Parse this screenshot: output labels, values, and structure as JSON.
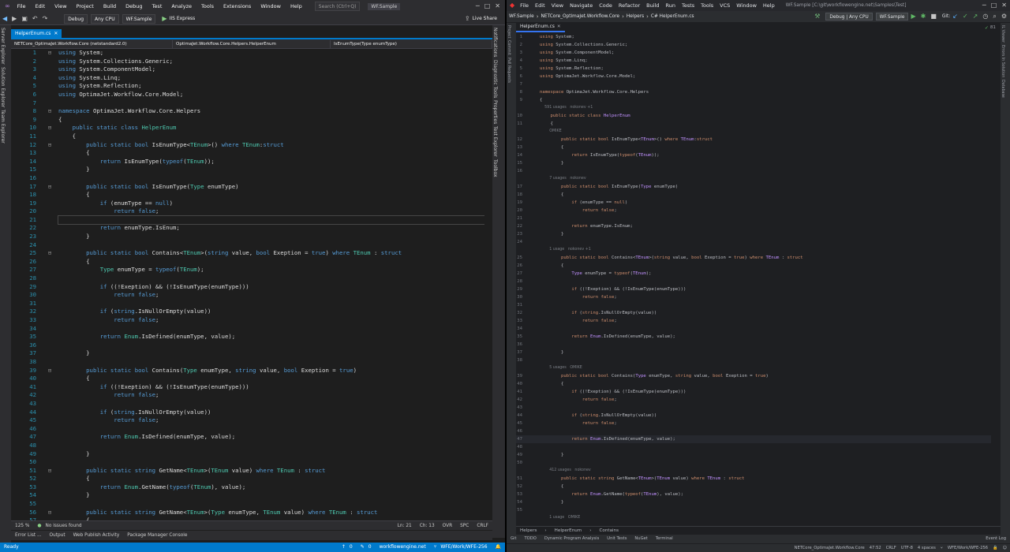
{
  "vs": {
    "menu": [
      "File",
      "Edit",
      "View",
      "Project",
      "Build",
      "Debug",
      "Test",
      "Analyze",
      "Tools",
      "Extensions",
      "Window",
      "Help"
    ],
    "search_placeholder": "Search (Ctrl+Q)",
    "solution_name": "WF.Sample",
    "toolbar": {
      "config": "Debug",
      "platform": "Any CPU",
      "startup": "WF.Sample",
      "run": "IIS Express",
      "live_share": "Live Share"
    },
    "left_strip": [
      "Server Explorer",
      "Solution Explorer",
      "Team Explorer"
    ],
    "right_strip": [
      "Notifications",
      "Diagnostic Tools",
      "Properties",
      "Test Explorer",
      "Toolbox"
    ],
    "tab": "HelperEnum.cs",
    "nav": {
      "project": "NETCore_OptimaJet.Workflow.Core (netstandard2.0)",
      "type": "OptimaJet.Workflow.Core.Helpers.HelperEnum",
      "member": "IsEnumType(Type enumType)"
    },
    "code": [
      {
        "n": "1",
        "f": "⊟",
        "t": "using System;"
      },
      {
        "n": "2",
        "f": "",
        "t": "using System.Collections.Generic;"
      },
      {
        "n": "3",
        "f": "",
        "t": "using System.ComponentModel;"
      },
      {
        "n": "4",
        "f": "",
        "t": "using System.Linq;"
      },
      {
        "n": "5",
        "f": "",
        "t": "using System.Reflection;"
      },
      {
        "n": "6",
        "f": "",
        "t": "using OptimaJet.Workflow.Core.Model;"
      },
      {
        "n": "7",
        "f": "",
        "t": ""
      },
      {
        "n": "8",
        "f": "⊟",
        "t": "namespace OptimaJet.Workflow.Core.Helpers"
      },
      {
        "n": "9",
        "f": "",
        "t": "{"
      },
      {
        "n": "10",
        "f": "⊟",
        "t": "    public static class HelperEnum"
      },
      {
        "n": "11",
        "f": "",
        "t": "    {"
      },
      {
        "n": "12",
        "f": "⊟",
        "t": "        public static bool IsEnumType<TEnum>() where TEnum:struct"
      },
      {
        "n": "13",
        "f": "",
        "t": "        {"
      },
      {
        "n": "14",
        "f": "",
        "t": "            return IsEnumType(typeof(TEnum));"
      },
      {
        "n": "15",
        "f": "",
        "t": "        }"
      },
      {
        "n": "16",
        "f": "",
        "t": ""
      },
      {
        "n": "17",
        "f": "⊟",
        "t": "        public static bool IsEnumType(Type enumType)"
      },
      {
        "n": "18",
        "f": "",
        "t": "        {"
      },
      {
        "n": "19",
        "f": "",
        "t": "            if (enumType == null)"
      },
      {
        "n": "20",
        "f": "",
        "t": "                return false;"
      },
      {
        "n": "21",
        "f": "",
        "t": ""
      },
      {
        "n": "22",
        "f": "",
        "t": "            return enumType.IsEnum;"
      },
      {
        "n": "23",
        "f": "",
        "t": "        }"
      },
      {
        "n": "24",
        "f": "",
        "t": ""
      },
      {
        "n": "25",
        "f": "⊟",
        "t": "        public static bool Contains<TEnum>(string value, bool Exeption = true) where TEnum : struct"
      },
      {
        "n": "26",
        "f": "",
        "t": "        {"
      },
      {
        "n": "27",
        "f": "",
        "t": "            Type enumType = typeof(TEnum);"
      },
      {
        "n": "28",
        "f": "",
        "t": ""
      },
      {
        "n": "29",
        "f": "",
        "t": "            if ((!Exeption) && (!IsEnumType(enumType)))"
      },
      {
        "n": "30",
        "f": "",
        "t": "                return false;"
      },
      {
        "n": "31",
        "f": "",
        "t": ""
      },
      {
        "n": "32",
        "f": "",
        "t": "            if (string.IsNullOrEmpty(value))"
      },
      {
        "n": "33",
        "f": "",
        "t": "                return false;"
      },
      {
        "n": "34",
        "f": "",
        "t": ""
      },
      {
        "n": "35",
        "f": "",
        "t": "            return Enum.IsDefined(enumType, value);"
      },
      {
        "n": "36",
        "f": "",
        "t": ""
      },
      {
        "n": "37",
        "f": "",
        "t": "        }"
      },
      {
        "n": "38",
        "f": "",
        "t": ""
      },
      {
        "n": "39",
        "f": "⊟",
        "t": "        public static bool Contains(Type enumType, string value, bool Exeption = true)"
      },
      {
        "n": "40",
        "f": "",
        "t": "        {"
      },
      {
        "n": "41",
        "f": "",
        "t": "            if ((!Exeption) && (!IsEnumType(enumType)))"
      },
      {
        "n": "42",
        "f": "",
        "t": "                return false;"
      },
      {
        "n": "43",
        "f": "",
        "t": ""
      },
      {
        "n": "44",
        "f": "",
        "t": "            if (string.IsNullOrEmpty(value))"
      },
      {
        "n": "45",
        "f": "",
        "t": "                return false;"
      },
      {
        "n": "46",
        "f": "",
        "t": ""
      },
      {
        "n": "47",
        "f": "",
        "t": "            return Enum.IsDefined(enumType, value);"
      },
      {
        "n": "48",
        "f": "",
        "t": ""
      },
      {
        "n": "49",
        "f": "",
        "t": "        }"
      },
      {
        "n": "50",
        "f": "",
        "t": ""
      },
      {
        "n": "51",
        "f": "⊟",
        "t": "        public static string GetName<TEnum>(TEnum value) where TEnum : struct"
      },
      {
        "n": "52",
        "f": "",
        "t": "        {"
      },
      {
        "n": "53",
        "f": "",
        "t": "            return Enum.GetName(typeof(TEnum), value);"
      },
      {
        "n": "54",
        "f": "",
        "t": "        }"
      },
      {
        "n": "55",
        "f": "",
        "t": ""
      },
      {
        "n": "56",
        "f": "⊟",
        "t": "        public static string GetName<TEnum>(Type enumType, TEnum value) where TEnum : struct"
      },
      {
        "n": "57",
        "f": "",
        "t": "        {"
      }
    ],
    "cursor_line": 21,
    "edit_status": {
      "zoom": "125 %",
      "issues": "No issues found",
      "ln": "Ln: 21",
      "ch": "Ch: 13",
      "ovr": "OVR",
      "spc": "SPC",
      "crlf": "CRLF"
    },
    "tool_windows": [
      "Error List ...",
      "Output",
      "Web Publish Activity",
      "Package Manager Console"
    ],
    "status": {
      "ready": "Ready",
      "up": "0",
      "pencil": "0",
      "repo": "workflowengine.net",
      "branch": "WFE/Work/WFE-256"
    }
  },
  "rd": {
    "menu": [
      "File",
      "Edit",
      "View",
      "Navigate",
      "Code",
      "Refactor",
      "Build",
      "Run",
      "Tests",
      "Tools",
      "VCS",
      "Window",
      "Help"
    ],
    "title": "WF.Sample [C:\\git\\workflowengine.net\\Samples\\Test]",
    "crumbs": [
      "WF.Sample",
      "NETCore_OptimaJet.Workflow.Core",
      "Helpers",
      "C# HelperEnum.cs"
    ],
    "config": "Debug | Any CPU",
    "run_config": "WF.Sample",
    "git": "Git:",
    "tab": "HelperEnum.cs",
    "inspection": "81",
    "left_strip": [
      "Project",
      "Commit",
      "Pull Requests"
    ],
    "right_strip": [
      "IL Viewer",
      "Errors In Solution",
      "Database"
    ],
    "code": [
      {
        "n": "1",
        "h": "",
        "t": "using System;"
      },
      {
        "n": "2",
        "h": "",
        "t": "using System.Collections.Generic;"
      },
      {
        "n": "3",
        "h": "",
        "t": "using System.ComponentModel;"
      },
      {
        "n": "4",
        "h": "",
        "t": "using System.Linq;"
      },
      {
        "n": "5",
        "h": "",
        "t": "using System.Reflection;"
      },
      {
        "n": "6",
        "h": "",
        "t": "using OptimaJet.Workflow.Core.Model;"
      },
      {
        "n": "7",
        "h": "",
        "t": ""
      },
      {
        "n": "8",
        "h": "",
        "t": "namespace OptimaJet.Workflow.Core.Helpers"
      },
      {
        "n": "9",
        "h": "",
        "t": "{"
      },
      {
        "n": "",
        "h": "    591 usages   nokonev +1",
        "t": ""
      },
      {
        "n": "10",
        "h": "",
        "t": "    public static class HelperEnum"
      },
      {
        "n": "11",
        "h": "",
        "t": "    {"
      },
      {
        "n": "",
        "h": "        OMIKE",
        "t": ""
      },
      {
        "n": "12",
        "h": "",
        "t": "        public static bool IsEnumType<TEnum>() where TEnum:struct"
      },
      {
        "n": "13",
        "h": "",
        "t": "        {"
      },
      {
        "n": "14",
        "h": "",
        "t": "            return IsEnumType(typeof(TEnum));"
      },
      {
        "n": "15",
        "h": "",
        "t": "        }"
      },
      {
        "n": "16",
        "h": "",
        "t": ""
      },
      {
        "n": "",
        "h": "        7 usages   nokonev",
        "t": ""
      },
      {
        "n": "17",
        "h": "",
        "t": "        public static bool IsEnumType(Type enumType)"
      },
      {
        "n": "18",
        "h": "",
        "t": "        {"
      },
      {
        "n": "19",
        "h": "",
        "t": "            if (enumType == null)"
      },
      {
        "n": "20",
        "h": "",
        "t": "                return false;"
      },
      {
        "n": "21",
        "h": "",
        "t": ""
      },
      {
        "n": "22",
        "h": "",
        "t": "            return enumType.IsEnum;"
      },
      {
        "n": "23",
        "h": "",
        "t": "        }"
      },
      {
        "n": "24",
        "h": "",
        "t": ""
      },
      {
        "n": "",
        "h": "        1 usage   nokonev +1",
        "t": ""
      },
      {
        "n": "25",
        "h": "",
        "t": "        public static bool Contains<TEnum>(string value, bool Exeption = true) where TEnum : struct"
      },
      {
        "n": "26",
        "h": "",
        "t": "        {"
      },
      {
        "n": "27",
        "h": "",
        "t": "            Type enumType = typeof(TEnum);"
      },
      {
        "n": "28",
        "h": "",
        "t": ""
      },
      {
        "n": "29",
        "h": "",
        "t": "            if ((!Exeption) && (!IsEnumType(enumType)))"
      },
      {
        "n": "30",
        "h": "",
        "t": "                return false;"
      },
      {
        "n": "31",
        "h": "",
        "t": ""
      },
      {
        "n": "32",
        "h": "",
        "t": "            if (string.IsNullOrEmpty(value))"
      },
      {
        "n": "33",
        "h": "",
        "t": "                return false;"
      },
      {
        "n": "34",
        "h": "",
        "t": ""
      },
      {
        "n": "35",
        "h": "",
        "t": "            return Enum.IsDefined(enumType, value);"
      },
      {
        "n": "36",
        "h": "",
        "t": ""
      },
      {
        "n": "37",
        "h": "",
        "t": "        }"
      },
      {
        "n": "38",
        "h": "",
        "t": ""
      },
      {
        "n": "",
        "h": "        5 usages   OMIKE",
        "t": ""
      },
      {
        "n": "39",
        "h": "",
        "t": "        public static bool Contains(Type enumType, string value, bool Exeption = true)"
      },
      {
        "n": "40",
        "h": "",
        "t": "        {"
      },
      {
        "n": "41",
        "h": "",
        "t": "            if ((!Exeption) && (!IsEnumType(enumType)))"
      },
      {
        "n": "42",
        "h": "",
        "t": "                return false;"
      },
      {
        "n": "43",
        "h": "",
        "t": ""
      },
      {
        "n": "44",
        "h": "",
        "t": "            if (string.IsNullOrEmpty(value))"
      },
      {
        "n": "45",
        "h": "",
        "t": "                return false;"
      },
      {
        "n": "46",
        "h": "",
        "t": ""
      },
      {
        "n": "47",
        "h": "",
        "t": "            return Enum.IsDefined(enumType, value);"
      },
      {
        "n": "48",
        "h": "",
        "t": ""
      },
      {
        "n": "49",
        "h": "",
        "t": "        }"
      },
      {
        "n": "50",
        "h": "",
        "t": ""
      },
      {
        "n": "",
        "h": "        412 usages   nokonev",
        "t": ""
      },
      {
        "n": "51",
        "h": "",
        "t": "        public static string GetName<TEnum>(TEnum value) where TEnum : struct"
      },
      {
        "n": "52",
        "h": "",
        "t": "        {"
      },
      {
        "n": "53",
        "h": "",
        "t": "            return Enum.GetName(typeof(TEnum), value);"
      },
      {
        "n": "54",
        "h": "",
        "t": "        }"
      },
      {
        "n": "55",
        "h": "",
        "t": ""
      },
      {
        "n": "",
        "h": "        1 usage   OMIKE",
        "t": ""
      }
    ],
    "cursor_line": 47,
    "breadcrumb": [
      "Helpers",
      "HelperEnum",
      "Contains"
    ],
    "tool_windows": [
      "Git",
      "TODO",
      "Dynamic Program Analysis",
      "Unit Tests",
      "NuGet",
      "Terminal",
      "Event Log"
    ],
    "status": {
      "project": "NETCore_OptimaJet.Workflow.Core",
      "pos": "47:52",
      "eol": "CRLF",
      "enc": "UTF-8",
      "indent": "4 spaces",
      "branch": "WFE/Work/WFE-256"
    }
  }
}
